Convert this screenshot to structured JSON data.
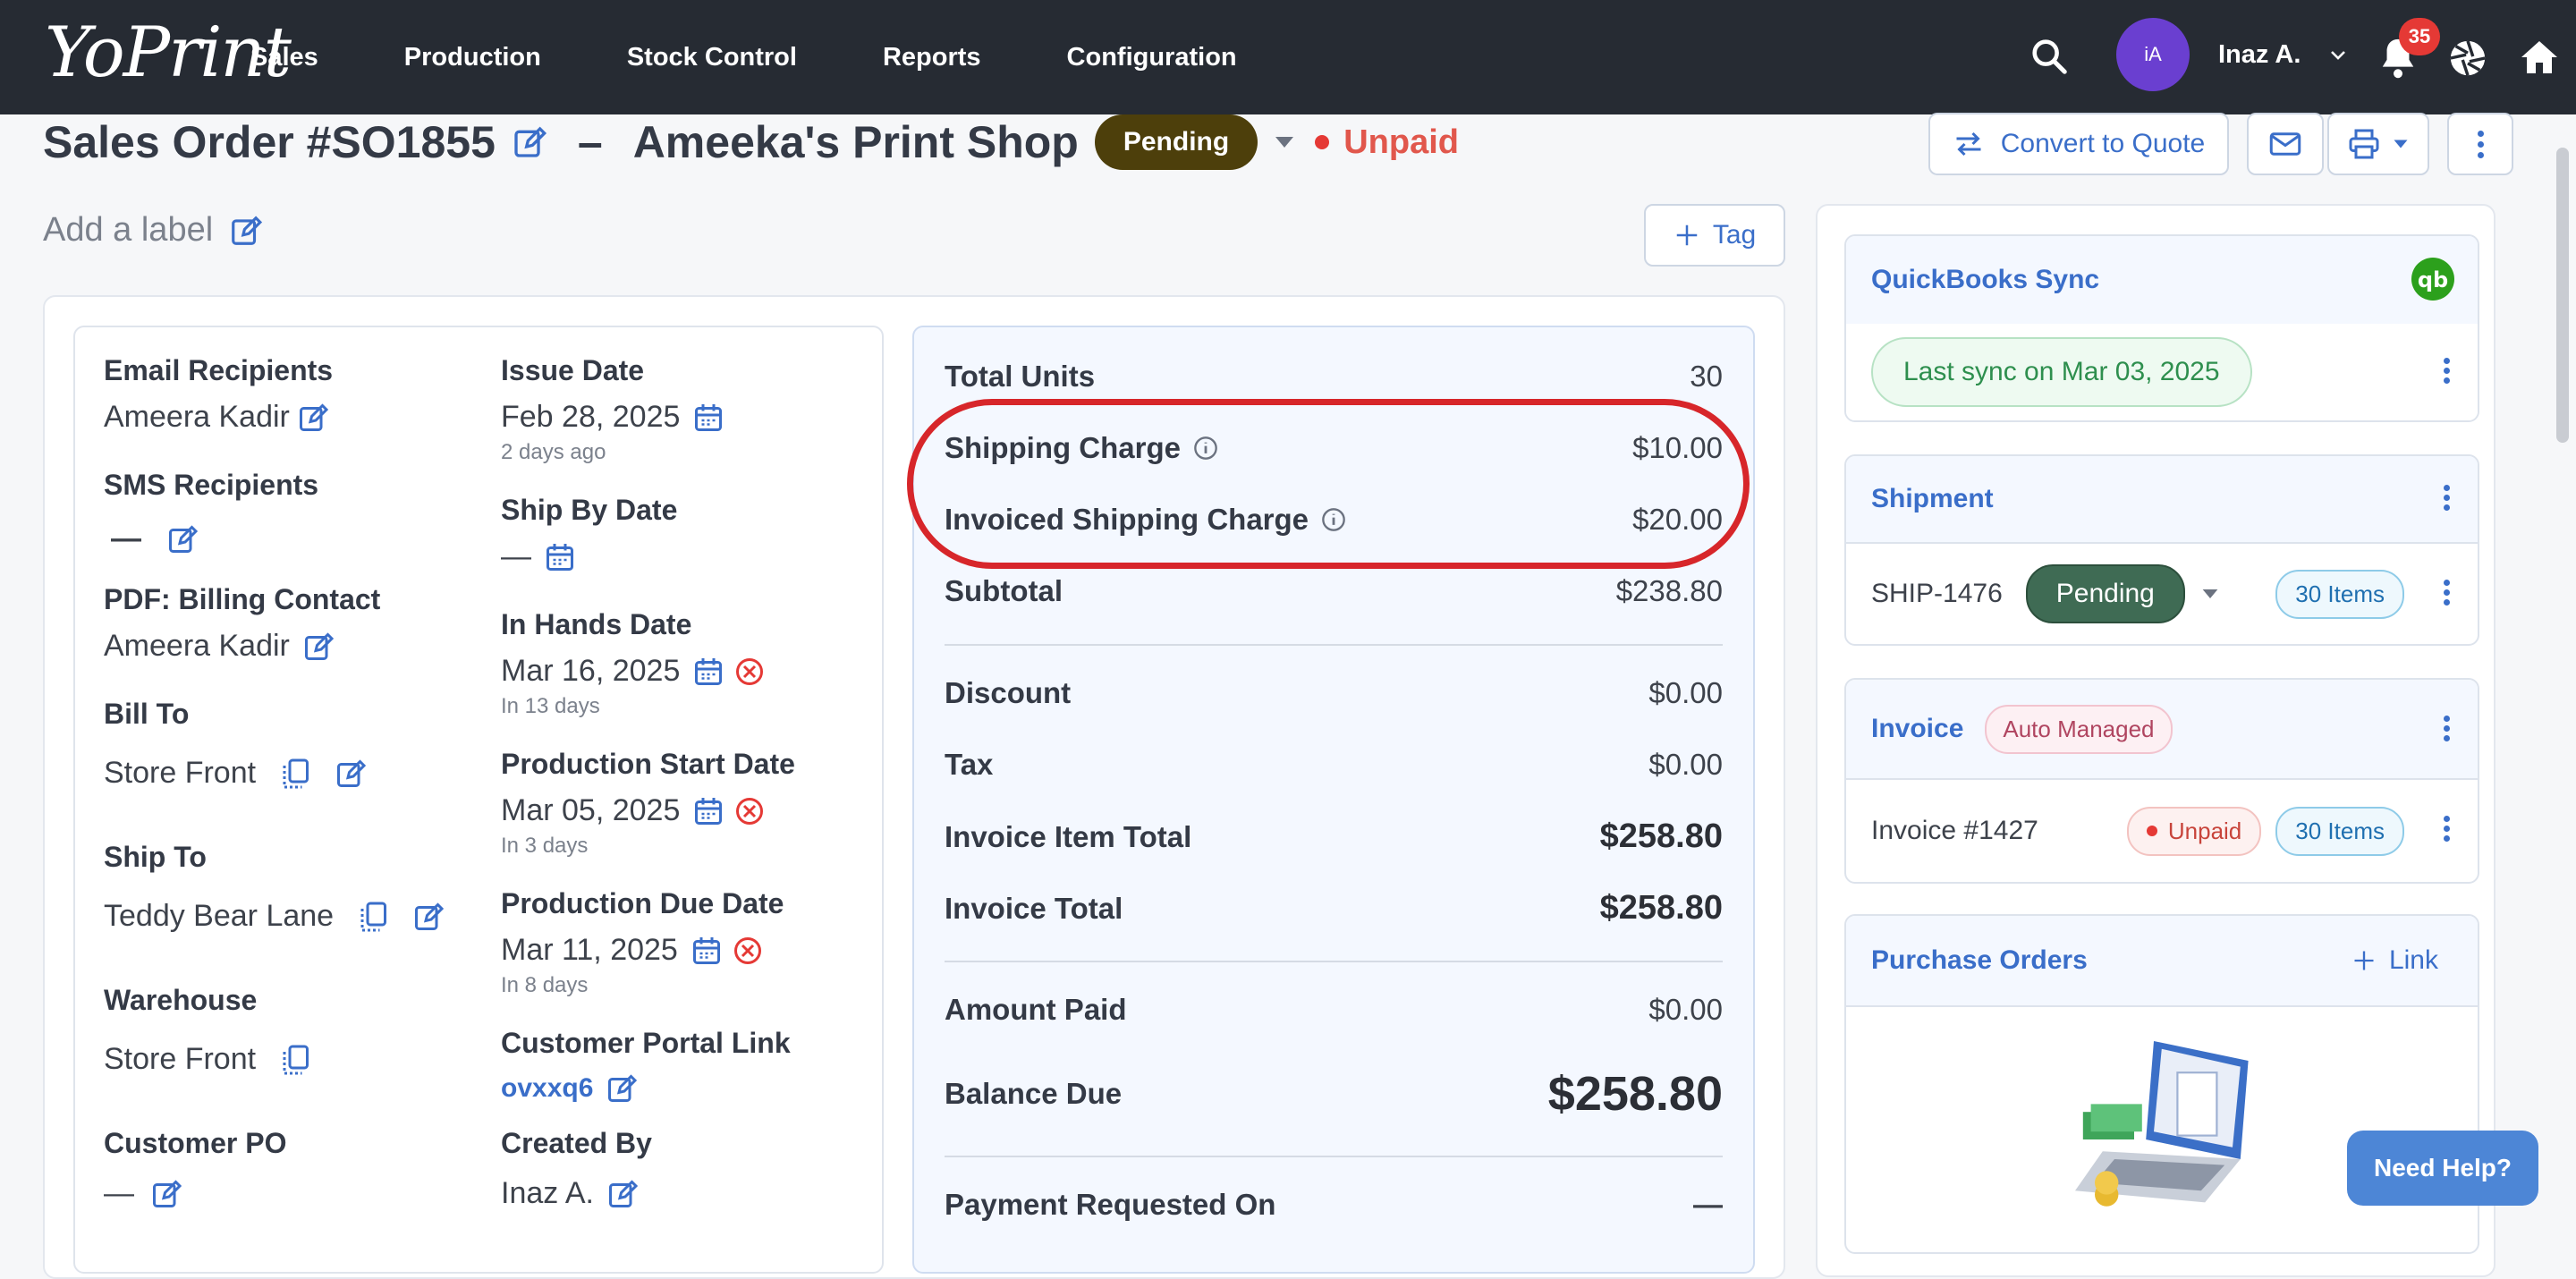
{
  "app": {
    "logo": "YoPrint"
  },
  "nav": {
    "items": [
      "Sales",
      "Production",
      "Stock Control",
      "Reports",
      "Configuration"
    ]
  },
  "user": {
    "initials": "iA",
    "name": "Inaz A.",
    "notifications": "35"
  },
  "order": {
    "title": "Sales Order #SO1855",
    "separator": "–",
    "customer": "Ameeka's Print Shop",
    "status": "Pending",
    "payment_status": "Unpaid",
    "add_label": "Add a label"
  },
  "header_actions": {
    "convert": "Convert to Quote",
    "tag": "Tag"
  },
  "details": {
    "email_label": "Email Recipients",
    "email_value": "Ameera Kadir",
    "sms_label": "SMS Recipients",
    "sms_value": "—",
    "pdf_label": "PDF: Billing Contact",
    "pdf_value": "Ameera Kadir",
    "bill_label": "Bill To",
    "bill_value": "Store Front",
    "ship_label": "Ship To",
    "ship_value": "Teddy Bear Lane",
    "warehouse_label": "Warehouse",
    "warehouse_value": "Store Front",
    "po_label": "Customer PO",
    "po_value": "—",
    "issue_label": "Issue Date",
    "issue_value": "Feb 28, 2025",
    "issue_sub": "2 days ago",
    "shipby_label": "Ship By Date",
    "shipby_value": "—",
    "inhands_label": "In Hands Date",
    "inhands_value": "Mar 16, 2025",
    "inhands_sub": "In 13 days",
    "prodstart_label": "Production Start Date",
    "prodstart_value": "Mar 05, 2025",
    "prodstart_sub": "In 3 days",
    "proddue_label": "Production Due Date",
    "proddue_value": "Mar 11, 2025",
    "proddue_sub": "In 8 days",
    "portal_label": "Customer Portal Link",
    "portal_value": "ovxxq6",
    "created_label": "Created By",
    "created_value": "Inaz A."
  },
  "summary": {
    "total_units_label": "Total Units",
    "total_units": "30",
    "shipping_label": "Shipping Charge",
    "shipping": "$10.00",
    "inv_shipping_label": "Invoiced Shipping Charge",
    "inv_shipping": "$20.00",
    "subtotal_label": "Subtotal",
    "subtotal": "$238.80",
    "discount_label": "Discount",
    "discount": "$0.00",
    "tax_label": "Tax",
    "tax": "$0.00",
    "inv_item_total_label": "Invoice Item Total",
    "inv_item_total": "$258.80",
    "inv_total_label": "Invoice Total",
    "inv_total": "$258.80",
    "paid_label": "Amount Paid",
    "paid": "$0.00",
    "balance_label": "Balance Due",
    "balance": "$258.80",
    "payreq_label": "Payment Requested On",
    "payreq": "—"
  },
  "side": {
    "qb_title": "QuickBooks Sync",
    "qb_sync": "Last sync on Mar 03, 2025",
    "shipment_title": "Shipment",
    "shipment_id": "SHIP-1476",
    "shipment_status": "Pending",
    "shipment_items": "30 Items",
    "invoice_title": "Invoice",
    "invoice_badge": "Auto Managed",
    "invoice_id": "Invoice #1427",
    "invoice_status": "Unpaid",
    "invoice_items": "30 Items",
    "po_title": "Purchase Orders",
    "po_link": "Link"
  },
  "help": "Need Help?",
  "colors": {
    "topbar": "#262b33",
    "accent": "#3a6ec9",
    "pending": "#4d3f0b",
    "unpaid": "#e1574c",
    "highlight": "#d7262a"
  }
}
